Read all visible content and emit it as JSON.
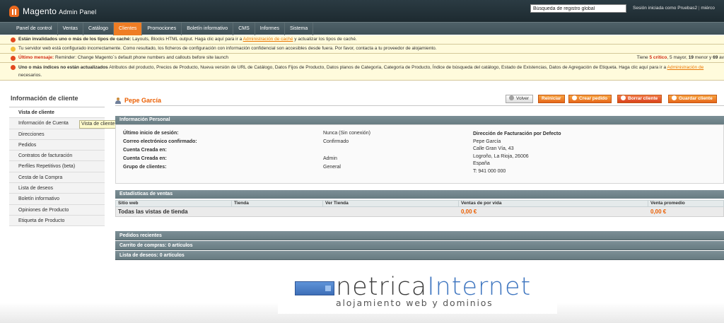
{
  "header": {
    "brand": "Magento",
    "brand_sub": "Admin Panel",
    "search_value": "Búsqueda de registro global",
    "session": "Sesión iniciada como Pruebas2",
    "session_sep": "|",
    "session_more": "miérco"
  },
  "nav": [
    "Panel de control",
    "Ventas",
    "Catálogo",
    "Clientes",
    "Promociones",
    "Boletín informativo",
    "CMS",
    "Informes",
    "Sistema"
  ],
  "nav_active": "Clientes",
  "messages": {
    "m1_bold": "Están invalidados uno o más de los tipos de caché:",
    "m1_text": " Layouts, Blocks HTML output. Haga clic aquí para ir a ",
    "m1_link": "Administración de caché",
    "m1_tail": " y actualizar los tipos de caché.",
    "m2_text": "Tu servidor web está configurado incorrectamente. Como resultado, los ficheros de configuración con información confidencial son accesibles desde fuera. Por favor, contacta a tu proveedor de alojamiento.",
    "m3_bold": "Último mensaje:",
    "m3_text": " Reminder: Change Magento`s default phone numbers and callouts before site launch",
    "m3_right_pre": "Tiene ",
    "m3_critical": "5 crítico",
    "m3_right_mid": ", 5 mayor, ",
    "m3_minor": "19",
    "m3_right_post": " menor y ",
    "m3_notice": "69",
    "m3_right_end": " av",
    "m4_bold": "Uno o más índices no están actualizados",
    "m4_text": " Atributos del producto, Precios de Producto, Nueva versión de URL de Catálogo, Datos Fijos de Producto, Datos planos de Categoría, Categoría de Producto, Índice de búsqueda del catálogo, Estado de Existencias, Datos de Agregación de Etiqueta. Haga clic aquí para ir a ",
    "m4_link": "Administración de",
    "m4_tail": " necesarios."
  },
  "sidebar": {
    "title": "Información de cliente",
    "items": [
      "Vista de cliente",
      "Información de Cuenta",
      "Direcciones",
      "Pedidos",
      "Contratos de facturación",
      "Perfiles Repetitivos (beta)",
      "Cesta de la Compra",
      "Lista de deseos",
      "Boletín informativo",
      "Opiniones de Producto",
      "Etiqueta de Producto"
    ],
    "tooltip": "Vista de cliente"
  },
  "page": {
    "title": "Pepe García",
    "buttons": {
      "back": "Volver",
      "reset": "Reiniciar",
      "create_order": "Crear pedido",
      "delete": "Borrar cliente",
      "save": "Guardar cliente"
    }
  },
  "personal": {
    "heading": "Información Personal",
    "labels": [
      "Último inicio de sesión:",
      "Correo electrónico confirmado:",
      "Cuenta Creada en:",
      "Cuenta Creada en:",
      "Grupo de clientes:"
    ],
    "values": [
      "Nunca (Sin conexión)",
      "Confirmado",
      "",
      "Admin",
      "General"
    ],
    "address_title": "Dirección de Facturación por Defecto",
    "address_lines": [
      "Pepe García",
      "Calle Gran Vía, 43",
      "Logroño, La Rioja, 26006",
      "España",
      "T: 941 000 000"
    ]
  },
  "stats": {
    "heading": "Estadísticas de ventas",
    "columns": [
      "Sitio web",
      "Tienda",
      "Ver Tienda",
      "Ventas de por vida",
      "Venta promedio"
    ],
    "row": {
      "label": "Todas las vistas de tienda",
      "lifetime": "0,00 €",
      "average": "0,00 €"
    }
  },
  "recent": {
    "orders": "Pedidos recientes",
    "cart": "Carrito de compras: 0 artículos",
    "wishlist": "Lista de deseos: 0 artículos"
  },
  "watermark": {
    "word1": "netrica",
    "word2": "Internet",
    "sub": "alojamiento web y dominios"
  },
  "colors": {
    "accent": "#ef7d24",
    "title": "#eb5e00",
    "section": "#6f8389"
  }
}
